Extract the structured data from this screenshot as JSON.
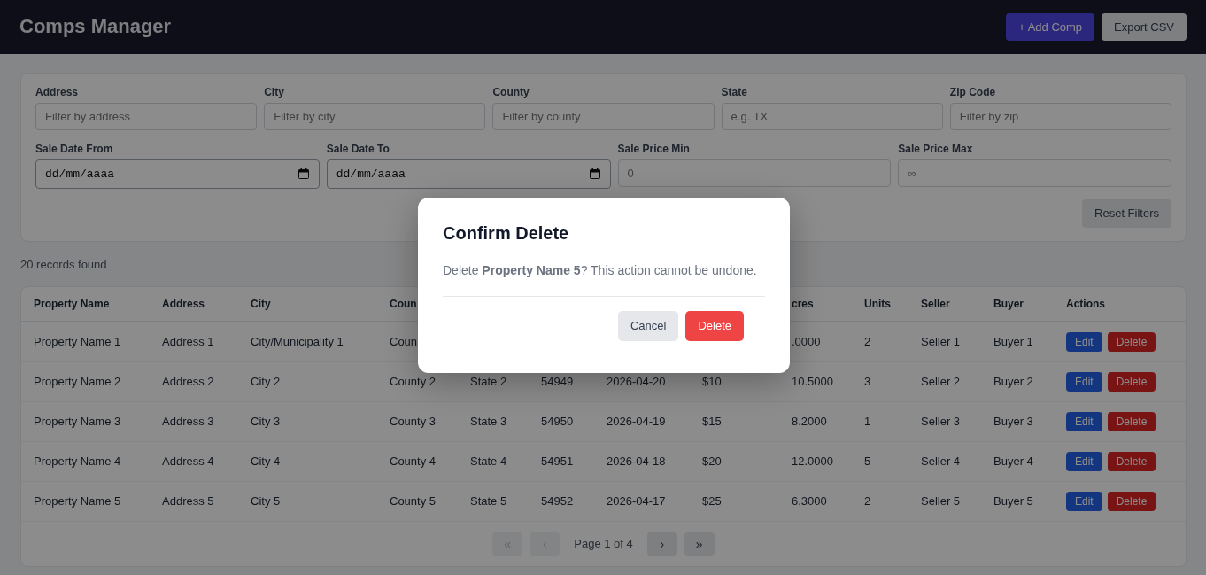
{
  "header": {
    "title": "Comps Manager",
    "buttons": [
      {
        "label": "+ Add Comp",
        "kind": "primary"
      },
      {
        "label": "Export CSV",
        "kind": "secondary"
      }
    ]
  },
  "filters": {
    "rows": [
      [
        {
          "label": "Address",
          "placeholder": "Filter by address",
          "kind": "text"
        },
        {
          "label": "City",
          "placeholder": "Filter by city",
          "kind": "text"
        },
        {
          "label": "County",
          "placeholder": "Filter by county",
          "kind": "text"
        },
        {
          "label": "State",
          "placeholder": "e.g. TX",
          "kind": "text"
        },
        {
          "label": "Zip Code",
          "placeholder": "Filter by zip",
          "kind": "text"
        }
      ],
      [
        {
          "label": "Sale Date From",
          "placeholder": "dd/mm/aaaa",
          "kind": "date"
        },
        {
          "label": "Sale Date To",
          "placeholder": "dd/mm/aaaa",
          "kind": "date"
        },
        {
          "label": "Sale Price Min",
          "placeholder": "0",
          "kind": "text"
        },
        {
          "label": "Sale Price Max",
          "placeholder": "∞",
          "kind": "text"
        }
      ]
    ],
    "reset_button": "Reset Filters"
  },
  "records_count": "20 records found",
  "table": {
    "columns": [
      "Property Name",
      "Address",
      "City",
      "Coun",
      null,
      null,
      null,
      null,
      "cres",
      "Units",
      "Seller",
      "Buyer",
      "Actions"
    ],
    "rows": [
      {
        "cells": [
          "Property Name 1",
          "Address 1",
          "City/Municipality 1",
          "Coun",
          null,
          null,
          null,
          null,
          ".0000",
          "2",
          "Seller 1",
          "Buyer 1"
        ],
        "actions": [
          "Edit",
          "Delete"
        ]
      },
      {
        "cells": [
          "Property Name 2",
          "Address 2",
          "City 2",
          "County 2",
          "State 2",
          "54949",
          "2026-04-20",
          "$10",
          "10.5000",
          "3",
          "Seller 2",
          "Buyer 2"
        ],
        "actions": [
          "Edit",
          "Delete"
        ]
      },
      {
        "cells": [
          "Property Name 3",
          "Address 3",
          "City 3",
          "County 3",
          "State 3",
          "54950",
          "2026-04-19",
          "$15",
          "8.2000",
          "1",
          "Seller 3",
          "Buyer 3"
        ],
        "actions": [
          "Edit",
          "Delete"
        ]
      },
      {
        "cells": [
          "Property Name 4",
          "Address 4",
          "City 4",
          "County 4",
          "State 4",
          "54951",
          "2026-04-18",
          "$20",
          "12.0000",
          "5",
          "Seller 4",
          "Buyer 4"
        ],
        "actions": [
          "Edit",
          "Delete"
        ]
      },
      {
        "cells": [
          "Property Name 5",
          "Address 5",
          "City 5",
          "County 5",
          "State 5",
          "54952",
          "2026-04-17",
          "$25",
          "6.3000",
          "2",
          "Seller 5",
          "Buyer 5"
        ],
        "actions": [
          "Edit",
          "Delete"
        ]
      }
    ]
  },
  "pagination": {
    "buttons": [
      {
        "label": "«",
        "disabled": true
      },
      {
        "label": "‹",
        "disabled": true
      },
      {
        "label": "›",
        "disabled": false
      },
      {
        "label": "»",
        "disabled": false
      }
    ],
    "page_text": "Page 1 of 4"
  },
  "modal": {
    "title": "Confirm Delete",
    "message": "Delete **Property Name 5**? This action cannot be undone.",
    "buttons": [
      {
        "label": "Cancel",
        "kind": "secondary"
      },
      {
        "label": "Delete",
        "kind": "danger"
      }
    ]
  }
}
